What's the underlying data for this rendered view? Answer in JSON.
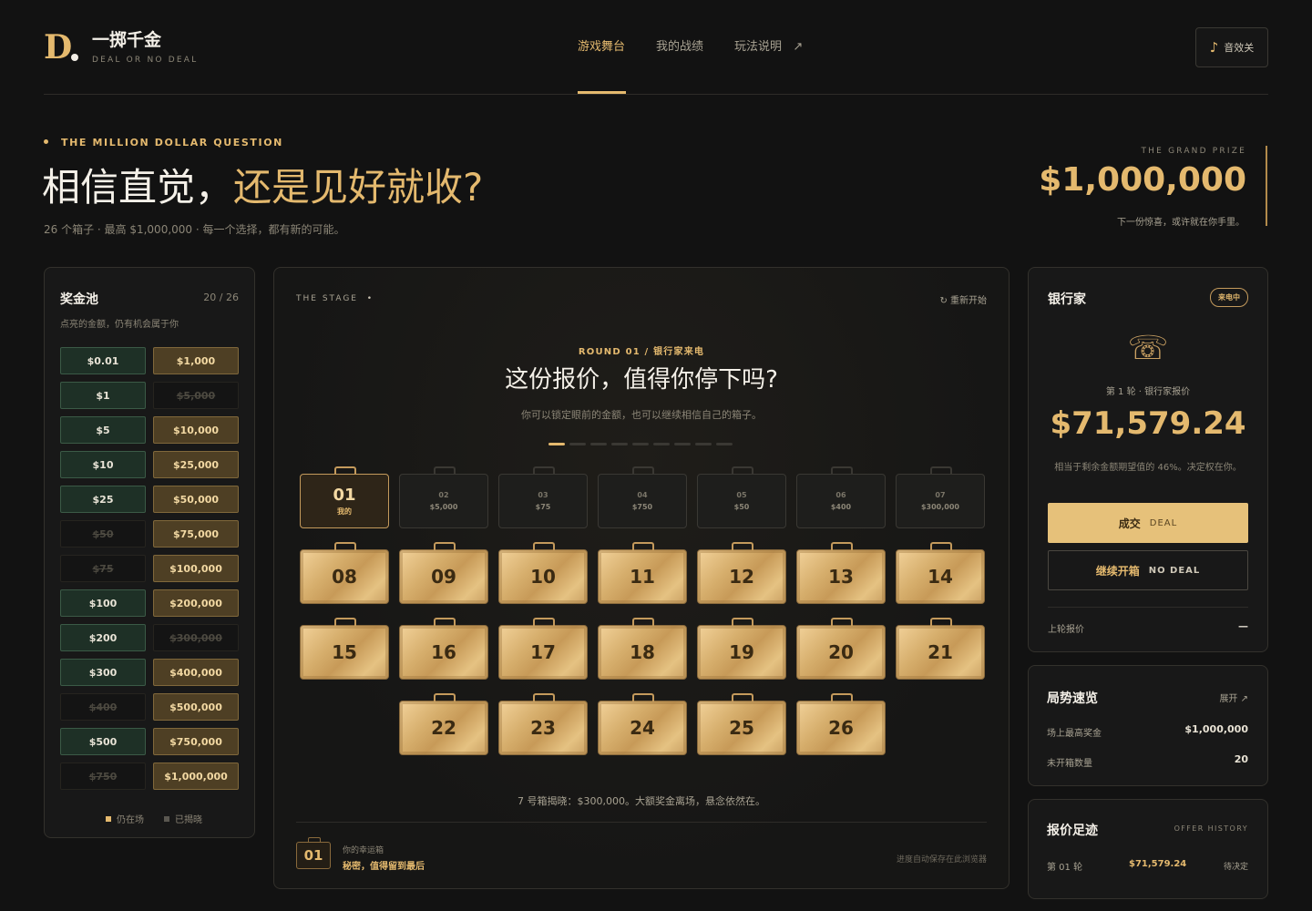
{
  "header": {
    "logo_letter": "D",
    "title": "一掷千金",
    "subtitle": "DEAL OR NO DEAL",
    "nav": [
      {
        "label": "游戏舞台",
        "active": true
      },
      {
        "label": "我的战绩",
        "active": false
      },
      {
        "label": "玩法说明",
        "active": false,
        "arrow": "↗"
      }
    ],
    "sound_icon": "♪",
    "sound_label": "音效关"
  },
  "hero": {
    "eyebrow": "THE MILLION DOLLAR QUESTION",
    "title_plain": "相信直觉，",
    "title_gold": "还是见好就收?",
    "subtitle": "26 个箱子 · 最高 $1,000,000 · 每一个选择，都有新的可能。",
    "grand_prize_label": "THE GRAND PRIZE",
    "grand_prize_value": "$1,000,000",
    "grand_prize_note": "下一份惊喜，或许就在你手里。"
  },
  "prize_pool": {
    "title": "奖金池",
    "count": "20 / 26",
    "subtitle": "点亮的金额，仍有机会属于你",
    "low": [
      {
        "v": "$0.01",
        "out": false
      },
      {
        "v": "$1",
        "out": false
      },
      {
        "v": "$5",
        "out": false
      },
      {
        "v": "$10",
        "out": false
      },
      {
        "v": "$25",
        "out": false
      },
      {
        "v": "$50",
        "out": true
      },
      {
        "v": "$75",
        "out": true
      },
      {
        "v": "$100",
        "out": false
      },
      {
        "v": "$200",
        "out": false
      },
      {
        "v": "$300",
        "out": false
      },
      {
        "v": "$400",
        "out": true
      },
      {
        "v": "$500",
        "out": false
      },
      {
        "v": "$750",
        "out": true
      }
    ],
    "high": [
      {
        "v": "$1,000",
        "out": false
      },
      {
        "v": "$5,000",
        "out": true
      },
      {
        "v": "$10,000",
        "out": false
      },
      {
        "v": "$25,000",
        "out": false
      },
      {
        "v": "$50,000",
        "out": false
      },
      {
        "v": "$75,000",
        "out": false
      },
      {
        "v": "$100,000",
        "out": false
      },
      {
        "v": "$200,000",
        "out": false
      },
      {
        "v": "$300,000",
        "out": true
      },
      {
        "v": "$400,000",
        "out": false
      },
      {
        "v": "$500,000",
        "out": false
      },
      {
        "v": "$750,000",
        "out": false
      },
      {
        "v": "$1,000,000",
        "out": false
      }
    ],
    "legend_in": "仍在场",
    "legend_out": "已揭晓"
  },
  "stage": {
    "label": "THE STAGE",
    "restart": "↻ 重新开始",
    "round": "ROUND 01 / 银行家来电",
    "question": "这份报价，值得你停下吗?",
    "question_sub": "你可以锁定眼前的金额，也可以继续相信自己的箱子。",
    "progress_total": 9,
    "progress_current": 1,
    "mine": {
      "n": "01",
      "tag": "我的"
    },
    "opened": [
      {
        "n": "02",
        "v": "$5,000"
      },
      {
        "n": "03",
        "v": "$75"
      },
      {
        "n": "04",
        "v": "$750"
      },
      {
        "n": "05",
        "v": "$50"
      },
      {
        "n": "06",
        "v": "$400"
      },
      {
        "n": "07",
        "v": "$300,000"
      }
    ],
    "closed": [
      "08",
      "09",
      "10",
      "11",
      "12",
      "13",
      "14",
      "15",
      "16",
      "17",
      "18",
      "19",
      "20",
      "21",
      "22",
      "23",
      "24",
      "25",
      "26"
    ],
    "reveal_msg": "7 号箱揭晓：$300,000。大额奖金离场，悬念依然在。",
    "lucky_num": "01",
    "lucky_label": "你的幸运箱",
    "lucky_sub": "秘密，值得留到最后",
    "autosave": "进度自动保存在此浏览器"
  },
  "banker": {
    "title": "银行家",
    "badge": "来电中",
    "phone_icon": "☏",
    "offer_label": "第 1 轮 · 银行家报价",
    "offer_value": "$71,579.24",
    "offer_note": "相当于剩余金额期望值的 46%。决定权在你。",
    "deal_cn": "成交",
    "deal_en": "DEAL",
    "nodeal_cn": "继续开箱",
    "nodeal_en": "NO DEAL",
    "last_offer_label": "上轮报价",
    "last_offer_value": "—"
  },
  "overview": {
    "title": "局势速览",
    "expand": "展开 ↗",
    "rows": [
      {
        "label": "场上最高奖金",
        "value": "$1,000,000"
      },
      {
        "label": "未开箱数量",
        "value": "20"
      }
    ]
  },
  "history": {
    "title": "报价足迹",
    "label_en": "OFFER HISTORY",
    "rows": [
      {
        "round": "第 01 轮",
        "value": "$71,579.24",
        "status": "待决定"
      }
    ]
  },
  "colors": {
    "gold": "#e4b96e",
    "bg": "#121212",
    "deal": "#e6c17a"
  }
}
